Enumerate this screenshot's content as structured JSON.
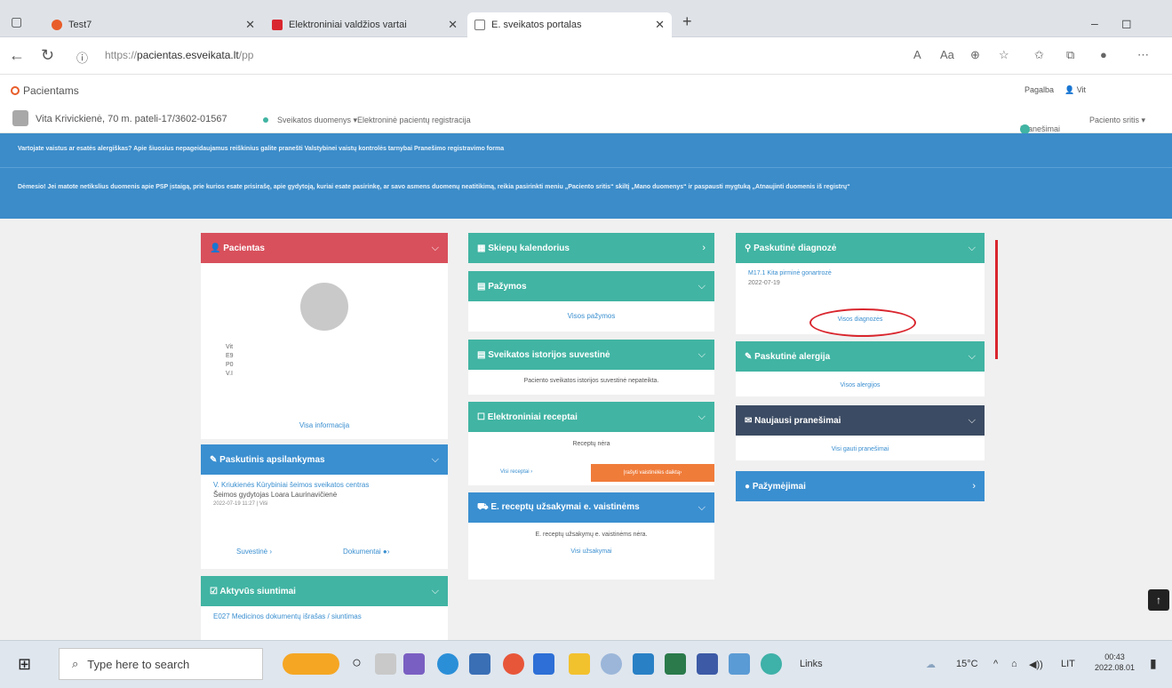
{
  "browser": {
    "tabs": [
      {
        "label": "Test7",
        "color": "#e85d2a"
      },
      {
        "label": "Elektroniniai valdžios vartai",
        "color": "#d9262e"
      },
      {
        "label": "E. sveikatos portalas",
        "color": "#ffffff"
      }
    ],
    "new_tab": "+",
    "url_prefix": "https://",
    "url_host": "pacientas.esveikata.lt",
    "url_path": "/pp"
  },
  "app": {
    "brand": "Pacientams",
    "help": "Pagalba",
    "user_short": "Vit"
  },
  "userbar": {
    "name": "Vita Krivickienė, 70 m. pateli-17/3602-01567",
    "menu_health": "Sveikatos duomenys ▾",
    "menu_registration": "Elektroninė pacientų registracija",
    "messages": "Pranešimai",
    "patient_card": "Paciento sritis ▾"
  },
  "banners": [
    "Vartojate vaistus ar esatės alergiškas? Apie šiuosius nepageidaujamus reiškinius galite pranešti Valstybinei vaistų kontrolės tarnybai Pranešimo registravimo forma",
    "Dėmesio! Jei matote netikslius duomenis apie PSP įstaigą, prie kurios esate prisirašę, apie gydytoją, kuriai esate pasirinkę, ar savo asmens duomenų neatitikimą, reikia pasirinkti meniu „Paciento sritis“ skiltį „Mano duomenys“ ir paspausti mygtuką „Atnaujinti duomenis iš registrų“"
  ],
  "cards": {
    "patient": {
      "title": "Pacientas",
      "lines": [
        "Vit",
        "E9",
        "P0",
        "V.I"
      ],
      "link": "Visa informacija"
    },
    "last_visit": {
      "title": "Paskutinis apsilankymas",
      "org": "V. Kriukienės Kūrybiniai šeimos sveikatos centras",
      "doctor": "Šeimos gydytojas Loara Laurinavičienė",
      "date": "2022-07-19 11:27  |  Viši",
      "summary": "Suvestinė",
      "documents": "Dokumentai"
    },
    "active": {
      "title": "Aktyvūs siuntimai",
      "item": "E027 Medicinos dokumentų išrašas / siuntimas"
    },
    "calendar": {
      "title": "Skiepų kalendorius"
    },
    "notes": {
      "title": "Pažymos",
      "link": "Visos pažymos"
    },
    "history": {
      "title": "Sveikatos istorijos suvestinė",
      "text": "Paciento sveikatos istorijos suvestinė nepateikta."
    },
    "prescriptions": {
      "title": "Elektroniniai receptai",
      "text": "Receptų nėra",
      "link": "Visi receptai",
      "button": "Įrašyti vaistinėlės daiktą"
    },
    "orders": {
      "title": "E. receptų užsakymai e. vaistinėms",
      "text": "E. receptų užsakymų e. vaistinėms nėra.",
      "link": "Visi užsakymai"
    },
    "diagnosis": {
      "title": "Paskutinė diagnozė",
      "code": "M17.1 Kita pirminė gonartrozė",
      "date": "2022-07-19",
      "link": "Visos diagnozės"
    },
    "allergy": {
      "title": "Paskutinė alergija",
      "link": "Visos alergijos"
    },
    "messages": {
      "title": "Naujausi pranešimai",
      "link": "Visi gauti pranešimai"
    },
    "certificates": {
      "title": "Pažymėjimai"
    }
  },
  "taskbar": {
    "search_placeholder": "Type here to search",
    "links": "Links",
    "weather": "15°C",
    "lang": "LIT",
    "time": "00:43",
    "date": "2022.08.01"
  }
}
